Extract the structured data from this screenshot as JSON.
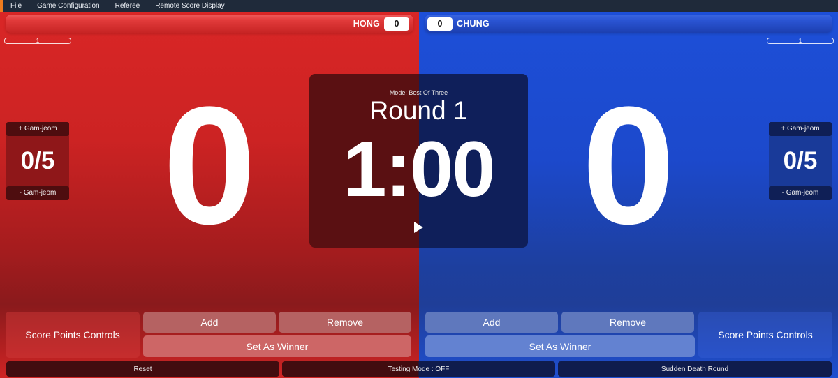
{
  "menu": {
    "items": [
      "File",
      "Game Configuration",
      "Referee",
      "Remote Score Display"
    ]
  },
  "colors": {
    "red_player": "#d92626",
    "blue_player": "#1d4fd8",
    "menu_accent": "#f07c1e"
  },
  "red": {
    "name": "HONG",
    "header_score": "0",
    "round_indicator": "1",
    "gamjeom": {
      "plus_label": "+ Gam-jeom",
      "value": "0/5",
      "minus_label": "- Gam-jeom"
    },
    "score": "0",
    "controls": {
      "title": "Score Points Controls",
      "add_label": "Add",
      "remove_label": "Remove",
      "winner_label": "Set As Winner"
    }
  },
  "blue": {
    "name": "CHUNG",
    "header_score": "0",
    "round_indicator": "1",
    "gamjeom": {
      "plus_label": "+ Gam-jeom",
      "value": "0/5",
      "minus_label": "- Gam-jeom"
    },
    "score": "0",
    "controls": {
      "title": "Score Points Controls",
      "add_label": "Add",
      "remove_label": "Remove",
      "winner_label": "Set As Winner"
    }
  },
  "timer": {
    "mode": "Mode: Best Of Three",
    "round": "Round 1",
    "clock": "1:00",
    "play_icon": "play-icon"
  },
  "footer": {
    "reset_label": "Reset",
    "testing_label": "Testing Mode : OFF",
    "sudden_death_label": "Sudden Death Round"
  }
}
